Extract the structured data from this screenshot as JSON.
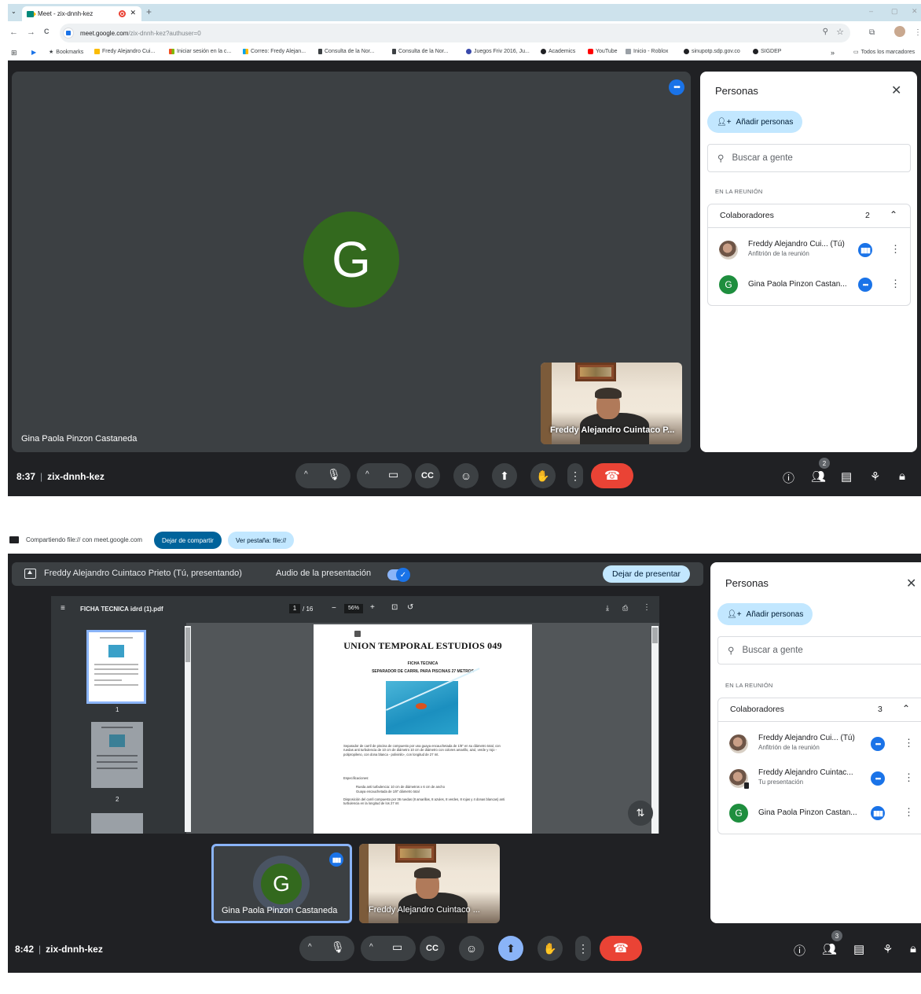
{
  "shot1": {
    "tab": {
      "title": "Meet - zix-dnnh-kez",
      "close": "✕",
      "new_tab": "+"
    },
    "window": {
      "minimize": "–",
      "restore": "▢",
      "close": "✕"
    },
    "nav": {
      "back": "←",
      "forward": "→",
      "reload": "C"
    },
    "omnibox": {
      "host": "meet.google.com",
      "path": "/zix-dnnh-kez?authuser=0"
    },
    "bookmarks": [
      "Bookmarks",
      "Fredy Alejandro Cui...",
      "Iniciar sesión en la c...",
      "Correo: Fredy Alejan...",
      "Consulta de la Nor...",
      "Consulta de la Nor...",
      "Juegos Friv 2016, Ju...",
      "Academics",
      "YouTube",
      "Inicio - Roblox",
      "sinupotp.sdp.gov.co",
      "SIGDEP"
    ],
    "bookmarks_more": "»",
    "all_bookmarks": "Todos los marcadores",
    "main_tile": {
      "avatar_letter": "G",
      "name": "Gina Paola Pinzon Castaneda"
    },
    "self_tile": {
      "name": "Freddy Alejandro Cuintaco P..."
    },
    "bottom": {
      "time": "8:37",
      "separator": "|",
      "meeting_code": "zix-dnnh-kez",
      "people_count": "2"
    },
    "people_panel": {
      "title": "Personas",
      "add_label": "Añadir personas",
      "search_placeholder": "Buscar a gente",
      "section": "EN LA REUNIÓN",
      "group_label": "Colaboradores",
      "group_count": "2",
      "participants": [
        {
          "name": "Freddy Alejandro Cui... (Tú)",
          "role": "Anfitrión de la reunión"
        },
        {
          "name": "Gina Paola Pinzon Castan...",
          "role": "",
          "avatar_letter": "G"
        }
      ]
    }
  },
  "shot2": {
    "share_bar": {
      "text": "Compartiendo file:// con meet.google.com",
      "stop_label": "Dejar de compartir",
      "view_label": "Ver pestaña: file://"
    },
    "presenting_bar": {
      "presenter": "Freddy Alejandro Cuintaco Prieto (Tú, presentando)",
      "audio_label": "Audio de la presentación",
      "audio_on": true,
      "stop_label": "Dejar de presentar"
    },
    "pdf": {
      "file_name": "FICHA TECNICA idrd (1).pdf",
      "page": "1",
      "total_pages": "/ 16",
      "zoom": "56%",
      "thumbnails": [
        "1",
        "2"
      ],
      "doc_title": "UNION TEMPORAL ESTUDIOS 049",
      "doc_heading": "FICHA TECNICA",
      "doc_subheading": "SEPARADOR DE CARRIL PARA PISCINAS 27 METROS",
      "doc_paragraph": "Separador de carril de piscina de compuesto por una guaya encauchetada de 1/8\" en su diámetro total, con ruedas anti turbulencia de 10 cm de diámetro 10 cm de diámetro con colores amarillo, azul, verde y rojo -polipropileno, con dona blanca - polivinilo-, con longitud de 27 mt.",
      "spec_heading": "Especificaciones:",
      "spec_items": [
        "Rueda anti turbulencia: 10 cm de diámetros x 6 cm de ancho",
        "Guaya encauchetada de 1/8\" diámetro total"
      ],
      "disposition": "Disposición del carril compuesto por 36 ruedas (8 amarillas, 8 azules, 8 verdes, 8 rojas y 4 donas blancas) anti turbulencia en la longitud de los 27 mt"
    },
    "tiles": [
      {
        "name": "Gina Paola Pinzon Castaneda",
        "avatar_letter": "G"
      },
      {
        "name": "Freddy Alejandro Cuintaco ..."
      }
    ],
    "bottom": {
      "time": "8:42",
      "separator": "|",
      "meeting_code": "zix-dnnh-kez",
      "people_count": "3"
    },
    "people_panel": {
      "title": "Personas",
      "add_label": "Añadir personas",
      "search_placeholder": "Buscar a gente",
      "section": "EN LA REUNIÓN",
      "group_label": "Colaboradores",
      "group_count": "3",
      "participants": [
        {
          "name": "Freddy Alejandro Cui... (Tú)",
          "role": "Anfitrión de la reunión"
        },
        {
          "name": "Freddy Alejandro Cuintac...",
          "role": "Tu presentación"
        },
        {
          "name": "Gina Paola Pinzon Castan...",
          "role": "",
          "avatar_letter": "G"
        }
      ]
    }
  },
  "colors": {
    "meet_bg": "#202124",
    "tile_bg": "#3c4043",
    "avatar_green": "#33691e",
    "accent_blue": "#1a73e8",
    "hangup_red": "#ea4335",
    "chip_blue": "#c2e7ff"
  },
  "icons": {
    "mic": "mic-icon",
    "camera": "camera-icon",
    "captions": "captions-icon",
    "emoji": "emoji-icon",
    "present": "present-icon",
    "hand": "raise-hand-icon",
    "more": "more-vert-icon",
    "hangup": "hangup-icon",
    "info": "info-icon",
    "people": "people-icon",
    "chat": "chat-icon",
    "activities": "activities-icon",
    "lock": "host-controls-icon"
  }
}
